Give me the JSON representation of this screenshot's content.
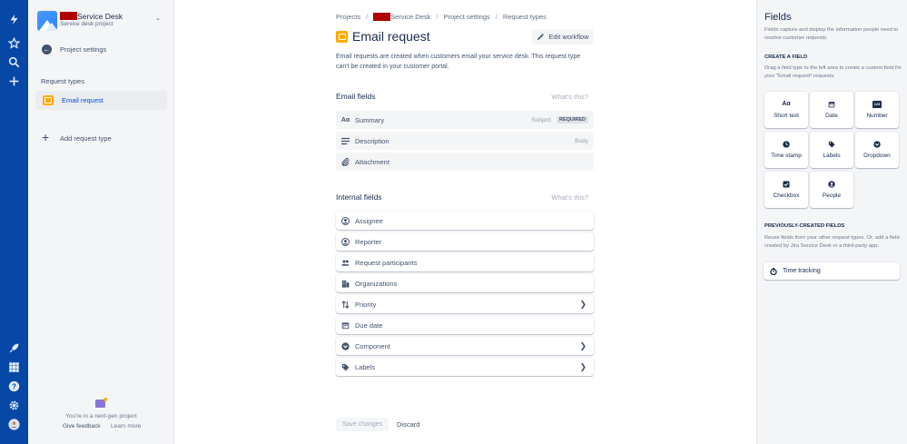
{
  "project": {
    "name": "Service Desk",
    "type": "Service desk project",
    "settings_link": "Project settings",
    "section_label": "Request types",
    "active_request_type": "Email request",
    "add_request_type": "Add request type",
    "nextgen_text": "You're in a next-gen project",
    "give_feedback": "Give feedback",
    "learn_more": "Learn more"
  },
  "breadcrumb": {
    "projects": "Projects",
    "project": "Service Desk",
    "project_settings": "Project settings",
    "request_types": "Request types"
  },
  "page": {
    "title": "Email request",
    "edit_workflow": "Edit workflow",
    "description": "Email requests are created when customers email your service desk. This request type can't be created in your customer portal."
  },
  "email_fields": {
    "title": "Email fields",
    "whats_this": "What's this?",
    "items": [
      {
        "label": "Summary",
        "mapping": "Subject",
        "badge": "REQUIRED",
        "icon": "text-icon"
      },
      {
        "label": "Description",
        "mapping": "Body",
        "icon": "paragraph-icon"
      },
      {
        "label": "Attachment",
        "icon": "paperclip-icon"
      }
    ]
  },
  "internal_fields": {
    "title": "Internal fields",
    "whats_this": "What's this?",
    "items": [
      {
        "label": "Assignee",
        "icon": "person-circle-icon"
      },
      {
        "label": "Reporter",
        "icon": "person-circle-icon"
      },
      {
        "label": "Request participants",
        "icon": "people-icon"
      },
      {
        "label": "Organizations",
        "icon": "office-building-icon"
      },
      {
        "label": "Priority",
        "icon": "priority-arrows-icon",
        "expandable": true
      },
      {
        "label": "Due date",
        "icon": "calendar-icon"
      },
      {
        "label": "Component",
        "icon": "dropdown-icon",
        "expandable": true
      },
      {
        "label": "Labels",
        "icon": "tag-icon",
        "expandable": true
      }
    ]
  },
  "actions": {
    "save": "Save changes",
    "discard": "Discard"
  },
  "fields_panel": {
    "title": "Fields",
    "description": "Fields capture and display the information people need to resolve customer requests.",
    "create_heading": "CREATE A FIELD",
    "create_desc": "Drag a field type to the left area to create a custom field for your \"Email request\" requests.",
    "types": [
      {
        "label": "Short text",
        "icon": "text-icon",
        "glyph": "Aα"
      },
      {
        "label": "Date",
        "icon": "calendar-icon"
      },
      {
        "label": "Number",
        "icon": "number-icon",
        "glyph": "123"
      },
      {
        "label": "Time stamp",
        "icon": "clock-icon"
      },
      {
        "label": "Labels",
        "icon": "tag-icon"
      },
      {
        "label": "Dropdown",
        "icon": "dropdown-icon"
      },
      {
        "label": "Checkbox",
        "icon": "checkbox-icon"
      },
      {
        "label": "People",
        "icon": "person-circle-icon"
      }
    ],
    "previous_heading": "PREVIOUSLY-CREATED FIELDS",
    "previous_desc": "Reuse fields from your other request types. Or, add a field created by Jira Service Desk or a third-party app.",
    "previous_items": [
      {
        "label": "Time tracking",
        "icon": "stopwatch-icon"
      }
    ]
  },
  "colors": {
    "global_nav": "#0747A6",
    "sidebar_bg": "#F4F5F7",
    "link": "#0052CC",
    "request_type_icon": "#FFAB00",
    "redaction": "#B00000"
  }
}
